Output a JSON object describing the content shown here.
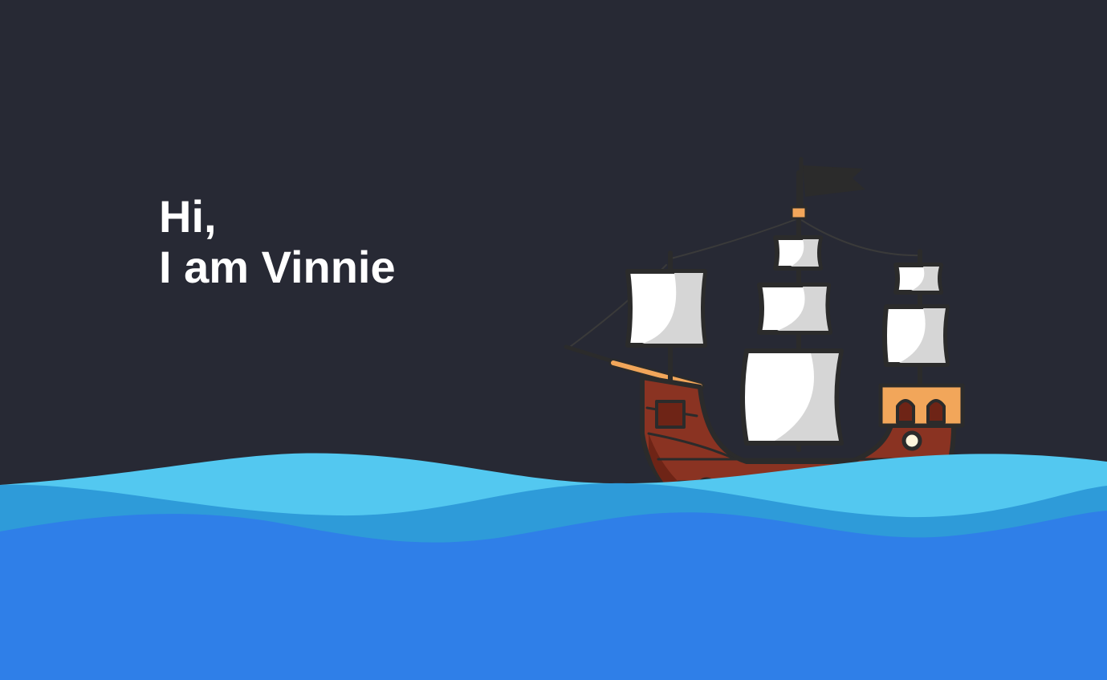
{
  "hero": {
    "line1": "Hi,",
    "line2": "I am Vinnie"
  },
  "illustration": {
    "subject": "pirate-ship",
    "icon": "ship-icon"
  },
  "colors": {
    "background": "#272934",
    "wave_light": "#53c8f0",
    "wave_mid": "#2e9bd9",
    "wave_deep": "#2f7fe8",
    "hull": "#8a3322",
    "hull_dark": "#6e2416",
    "sail": "#ffffff",
    "sail_shade": "#d6d6d6",
    "trim": "#f2a65a",
    "outline": "#2b2b2b",
    "text": "#ffffff"
  }
}
